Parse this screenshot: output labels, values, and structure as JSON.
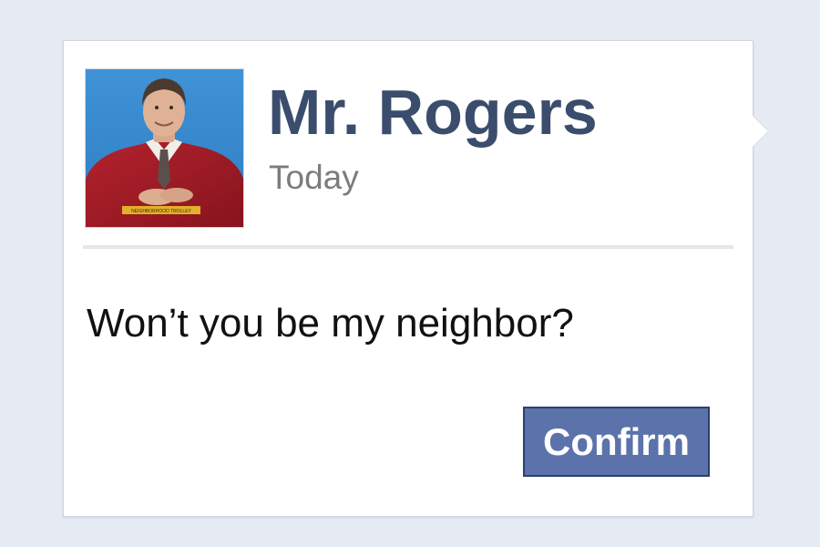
{
  "request": {
    "name": "Mr. Rogers",
    "timestamp": "Today",
    "message": "Won’t you be my neighbor?",
    "confirm_label": "Confirm",
    "avatar_sign_text": "NEIGHBORHOOD TROLLEY"
  },
  "colors": {
    "page_background": "#e6ebf3",
    "card_background": "#ffffff",
    "name_text": "#3b4d6c",
    "timestamp_text": "#7c7c7c",
    "button_background": "#5b72ab",
    "button_border": "#2c3f70",
    "avatar_background": "#3d8fd2"
  }
}
